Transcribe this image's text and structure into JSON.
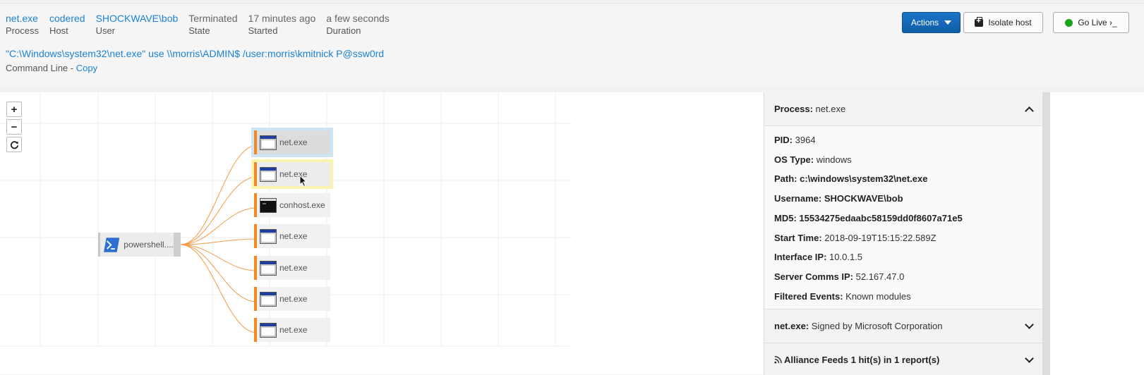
{
  "summary": [
    {
      "value": "net.exe",
      "label": "Process",
      "link": true
    },
    {
      "value": "codered",
      "label": "Host",
      "link": true
    },
    {
      "value": "SHOCKWAVE\\bob",
      "label": "User",
      "link": true
    },
    {
      "value": "Terminated",
      "label": "State",
      "link": false
    },
    {
      "value": "17 minutes ago",
      "label": "Started",
      "link": false
    },
    {
      "value": "a few seconds",
      "label": "Duration",
      "link": false
    }
  ],
  "command": {
    "line": "\"C:\\Windows\\system32\\net.exe\" use \\\\morris\\ADMIN$ /user:morris\\kmitnick P@ssw0rd",
    "label": "Command Line - ",
    "copy": "Copy"
  },
  "toolbar": {
    "actions_label": "Actions",
    "isolate_label": "Isolate host",
    "golive_label": "Go Live ›_"
  },
  "zoom": {
    "in": "+",
    "out": "−"
  },
  "graph": {
    "parent": "powershell....",
    "children": [
      "net.exe",
      "net.exe",
      "conhost.exe",
      "net.exe",
      "net.exe",
      "net.exe",
      "net.exe"
    ]
  },
  "details": {
    "title_label": "Process:",
    "title_value": "net.exe",
    "rows": [
      {
        "label": "PID:",
        "value": "3964",
        "bold": false
      },
      {
        "label": "OS Type:",
        "value": "windows",
        "bold": false
      },
      {
        "label": "Path:",
        "value": "c:\\windows\\system32\\net.exe",
        "bold": true
      },
      {
        "label": "Username:",
        "value": "SHOCKWAVE\\bob",
        "bold": true
      },
      {
        "label": "MD5:",
        "value": "15534275edaabc58159dd0f8607a71e5",
        "bold": true
      },
      {
        "label": "Start Time:",
        "value": "2018-09-19T15:15:22.589Z",
        "bold": false
      },
      {
        "label": "Interface IP:",
        "value": "10.0.1.5",
        "bold": false
      },
      {
        "label": "Server Comms IP:",
        "value": "52.167.47.0",
        "bold": false
      },
      {
        "label": "Filtered Events:",
        "value": "Known modules",
        "bold": false
      }
    ],
    "signed_label": "net.exe:",
    "signed_value": "Signed by Microsoft Corporation",
    "feeds_label": "Alliance Feeds 1 hit(s) in 1 report(s)"
  },
  "colors": {
    "accent": "#1a82d4",
    "edge": "#f08a24",
    "actions_btn": "#1267b8",
    "live_dot": "#1aa31a"
  }
}
